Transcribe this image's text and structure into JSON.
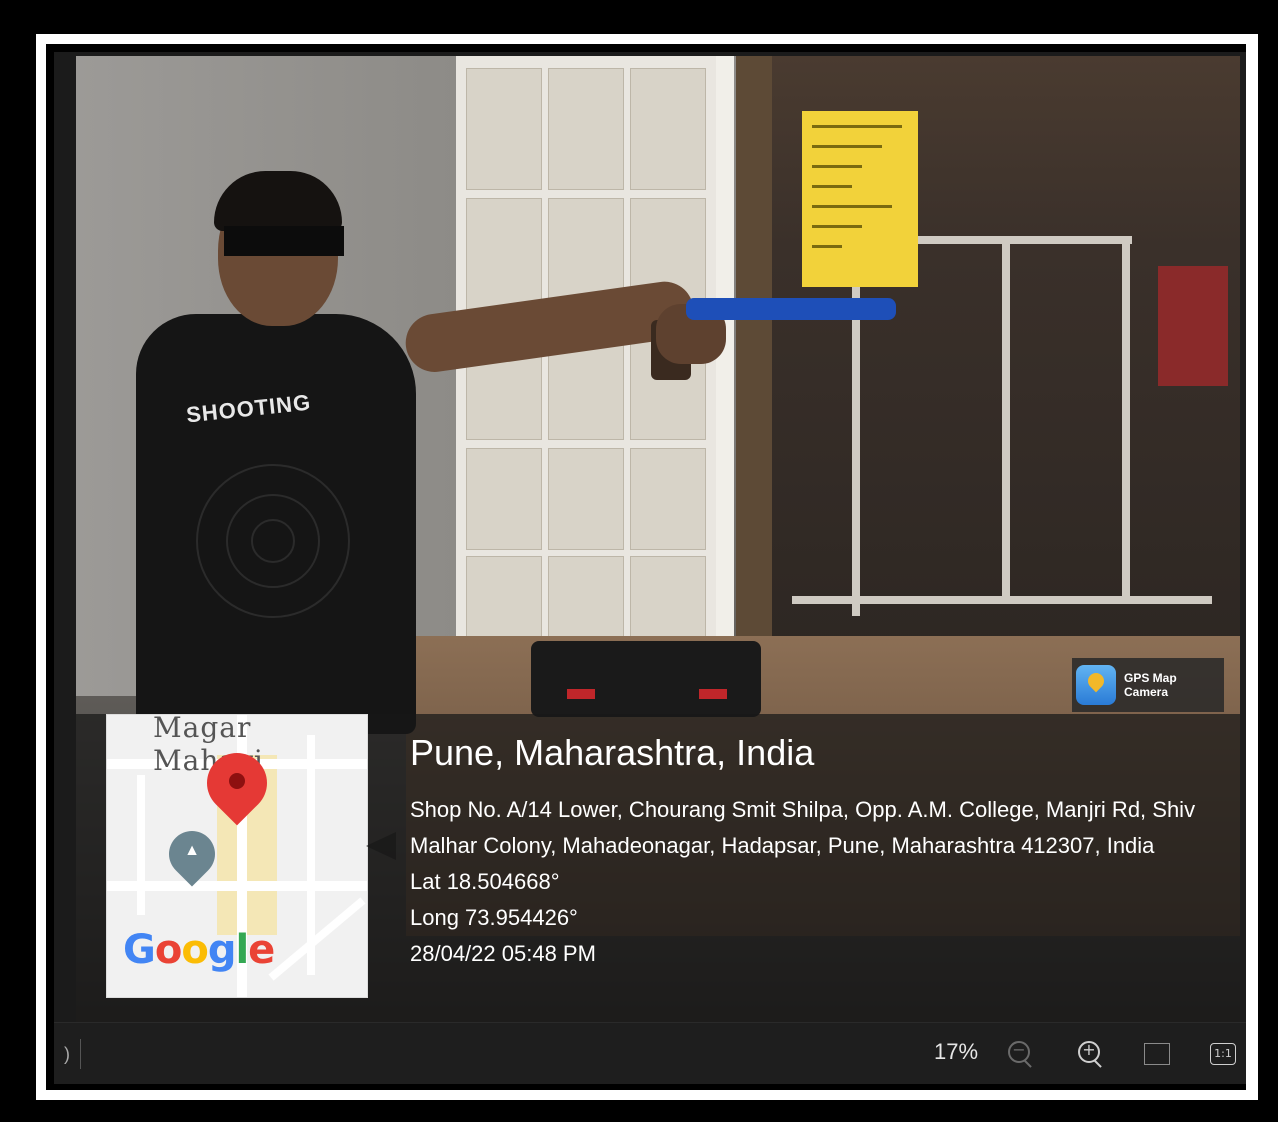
{
  "photo": {
    "shirt_text": "SHOOTING"
  },
  "gps_badge": {
    "label": "GPS Map Camera"
  },
  "map": {
    "street_label": "Magar Mahavi",
    "logo_letters": [
      "G",
      "o",
      "o",
      "g",
      "l",
      "e"
    ]
  },
  "location": {
    "title": "Pune, Maharashtra, India",
    "address_line1": "Shop No. A/14 Lower, Chourang Smit Shilpa, Opp. A.M. College, Manjri Rd, Shiv",
    "address_line2": "Malhar Colony, Mahadeonagar, Hadapsar, Pune, Maharashtra 412307, India",
    "lat": "Lat 18.504668°",
    "long": "Long 73.954426°",
    "datetime": "28/04/22 05:48 PM"
  },
  "toolbar": {
    "left_glyph": ")",
    "zoom_level": "17%",
    "zoom_out_sign": "−",
    "zoom_in_sign": "+",
    "one_to_one": "1:1"
  },
  "colors": {
    "gun_blue": "#1e4fb8",
    "notice_yellow": "#f2d23a",
    "map_pin_red": "#e53935"
  },
  "icons": [
    "gps-map-camera-icon",
    "map-pin-icon",
    "school-pin-icon",
    "zoom-out-icon",
    "zoom-in-icon",
    "fit-screen-icon",
    "actual-size-icon"
  ]
}
